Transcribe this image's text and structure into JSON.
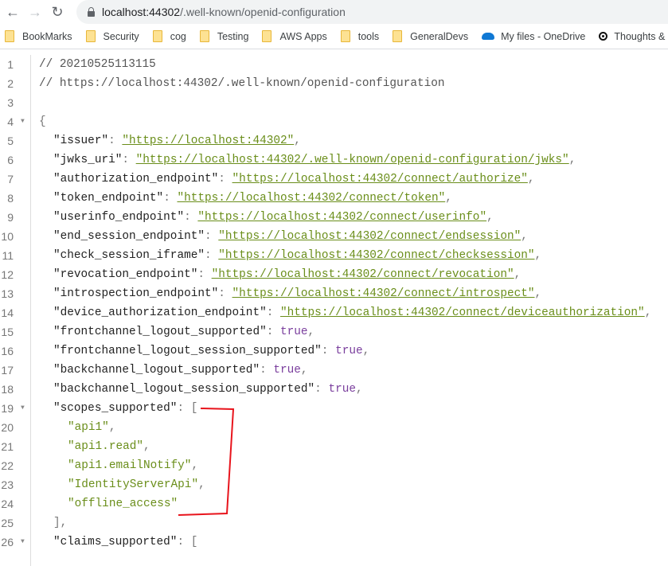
{
  "browser": {
    "url_host": "localhost:44302",
    "url_path": "/.well-known/openid-configuration",
    "bookmarks": [
      {
        "label": "BookMarks",
        "icon": "folder-icon"
      },
      {
        "label": "Security",
        "icon": "folder-icon"
      },
      {
        "label": "cog",
        "icon": "folder-icon"
      },
      {
        "label": "Testing",
        "icon": "folder-icon"
      },
      {
        "label": "AWS Apps",
        "icon": "folder-icon"
      },
      {
        "label": "tools",
        "icon": "folder-icon"
      },
      {
        "label": "GeneralDevs",
        "icon": "folder-icon"
      },
      {
        "label": "My files - OneDrive",
        "icon": "onedrive-icon"
      },
      {
        "label": "Thoughts & Exp",
        "icon": "target-icon"
      }
    ]
  },
  "lines": [
    {
      "n": "1",
      "i": 0,
      "t": [
        [
          "// 20210525113115",
          "comment"
        ]
      ]
    },
    {
      "n": "2",
      "i": 0,
      "t": [
        [
          "// https://localhost:44302/.well-known/openid-configuration",
          "comment"
        ]
      ]
    },
    {
      "n": "3",
      "i": 0,
      "t": []
    },
    {
      "n": "4",
      "i": 0,
      "fold": true,
      "t": [
        [
          "{",
          "punc"
        ]
      ]
    },
    {
      "n": "5",
      "i": 1,
      "t": [
        [
          "\"issuer\"",
          "key"
        ],
        [
          ": ",
          "punc"
        ],
        [
          "\"https://localhost:44302\"",
          "url"
        ],
        [
          ",",
          "punc"
        ]
      ]
    },
    {
      "n": "6",
      "i": 1,
      "t": [
        [
          "\"jwks_uri\"",
          "key"
        ],
        [
          ": ",
          "punc"
        ],
        [
          "\"https://localhost:44302/.well-known/openid-configuration/jwks\"",
          "url"
        ],
        [
          ",",
          "punc"
        ]
      ]
    },
    {
      "n": "7",
      "i": 1,
      "t": [
        [
          "\"authorization_endpoint\"",
          "key"
        ],
        [
          ": ",
          "punc"
        ],
        [
          "\"https://localhost:44302/connect/authorize\"",
          "url"
        ],
        [
          ",",
          "punc"
        ]
      ]
    },
    {
      "n": "8",
      "i": 1,
      "t": [
        [
          "\"token_endpoint\"",
          "key"
        ],
        [
          ": ",
          "punc"
        ],
        [
          "\"https://localhost:44302/connect/token\"",
          "url"
        ],
        [
          ",",
          "punc"
        ]
      ]
    },
    {
      "n": "9",
      "i": 1,
      "t": [
        [
          "\"userinfo_endpoint\"",
          "key"
        ],
        [
          ": ",
          "punc"
        ],
        [
          "\"https://localhost:44302/connect/userinfo\"",
          "url"
        ],
        [
          ",",
          "punc"
        ]
      ]
    },
    {
      "n": "10",
      "i": 1,
      "t": [
        [
          "\"end_session_endpoint\"",
          "key"
        ],
        [
          ": ",
          "punc"
        ],
        [
          "\"https://localhost:44302/connect/endsession\"",
          "url"
        ],
        [
          ",",
          "punc"
        ]
      ]
    },
    {
      "n": "11",
      "i": 1,
      "t": [
        [
          "\"check_session_iframe\"",
          "key"
        ],
        [
          ": ",
          "punc"
        ],
        [
          "\"https://localhost:44302/connect/checksession\"",
          "url"
        ],
        [
          ",",
          "punc"
        ]
      ]
    },
    {
      "n": "12",
      "i": 1,
      "t": [
        [
          "\"revocation_endpoint\"",
          "key"
        ],
        [
          ": ",
          "punc"
        ],
        [
          "\"https://localhost:44302/connect/revocation\"",
          "url"
        ],
        [
          ",",
          "punc"
        ]
      ]
    },
    {
      "n": "13",
      "i": 1,
      "t": [
        [
          "\"introspection_endpoint\"",
          "key"
        ],
        [
          ": ",
          "punc"
        ],
        [
          "\"https://localhost:44302/connect/introspect\"",
          "url"
        ],
        [
          ",",
          "punc"
        ]
      ]
    },
    {
      "n": "14",
      "i": 1,
      "t": [
        [
          "\"device_authorization_endpoint\"",
          "key"
        ],
        [
          ": ",
          "punc"
        ],
        [
          "\"https://localhost:44302/connect/deviceauthorization\"",
          "url"
        ],
        [
          ",",
          "punc"
        ]
      ]
    },
    {
      "n": "15",
      "i": 1,
      "t": [
        [
          "\"frontchannel_logout_supported\"",
          "key"
        ],
        [
          ": ",
          "punc"
        ],
        [
          "true",
          "bool"
        ],
        [
          ",",
          "punc"
        ]
      ]
    },
    {
      "n": "16",
      "i": 1,
      "t": [
        [
          "\"frontchannel_logout_session_supported\"",
          "key"
        ],
        [
          ": ",
          "punc"
        ],
        [
          "true",
          "bool"
        ],
        [
          ",",
          "punc"
        ]
      ]
    },
    {
      "n": "17",
      "i": 1,
      "t": [
        [
          "\"backchannel_logout_supported\"",
          "key"
        ],
        [
          ": ",
          "punc"
        ],
        [
          "true",
          "bool"
        ],
        [
          ",",
          "punc"
        ]
      ]
    },
    {
      "n": "18",
      "i": 1,
      "t": [
        [
          "\"backchannel_logout_session_supported\"",
          "key"
        ],
        [
          ": ",
          "punc"
        ],
        [
          "true",
          "bool"
        ],
        [
          ",",
          "punc"
        ]
      ]
    },
    {
      "n": "19",
      "i": 1,
      "fold": true,
      "t": [
        [
          "\"scopes_supported\"",
          "key"
        ],
        [
          ": [",
          "punc"
        ]
      ]
    },
    {
      "n": "20",
      "i": 2,
      "t": [
        [
          "\"api1\"",
          "str"
        ],
        [
          ",",
          "punc"
        ]
      ]
    },
    {
      "n": "21",
      "i": 2,
      "t": [
        [
          "\"api1.read\"",
          "str"
        ],
        [
          ",",
          "punc"
        ]
      ]
    },
    {
      "n": "22",
      "i": 2,
      "t": [
        [
          "\"api1.emailNotify\"",
          "str"
        ],
        [
          ",",
          "punc"
        ]
      ]
    },
    {
      "n": "23",
      "i": 2,
      "t": [
        [
          "\"IdentityServerApi\"",
          "str"
        ],
        [
          ",",
          "punc"
        ]
      ]
    },
    {
      "n": "24",
      "i": 2,
      "t": [
        [
          "\"offline_access\"",
          "str"
        ]
      ]
    },
    {
      "n": "25",
      "i": 1,
      "t": [
        [
          "],",
          "punc"
        ]
      ]
    },
    {
      "n": "26",
      "i": 1,
      "fold": true,
      "t": [
        [
          "\"claims_supported\"",
          "key"
        ],
        [
          ": [",
          "punc"
        ]
      ]
    }
  ],
  "colors": {
    "annotation": "#e8141c",
    "string": "#6a8e1a",
    "bool": "#7a3e9d"
  }
}
